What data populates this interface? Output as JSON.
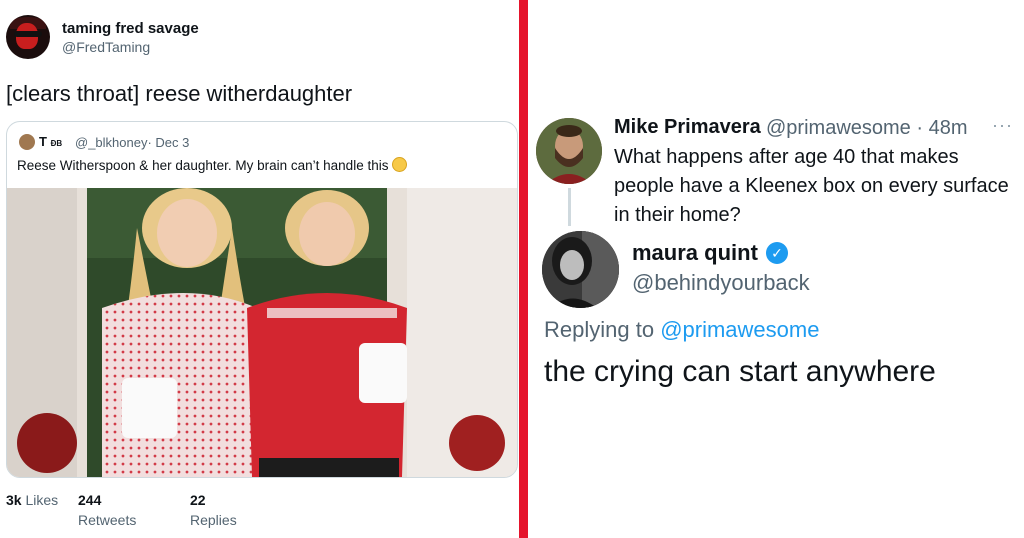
{
  "left_tweet": {
    "author_name": "taming fred savage",
    "author_handle": "@FredTaming",
    "text": "[clears throat] reese witherdaughter",
    "quote": {
      "author_name": "T",
      "author_badge": "ÐB",
      "author_handle": "@_blkhoney",
      "date": "· Dec 3",
      "text": "Reese Witherspoon & her daughter. My brain can’t handle this",
      "emoji": "slightly-smiling-face-icon"
    },
    "stats": {
      "likes_count": "3k",
      "likes_label": "Likes",
      "retweets_count": "244",
      "retweets_label": "Retweets",
      "replies_count": "22",
      "replies_label": "Replies"
    }
  },
  "right_tweet": {
    "parent": {
      "author_name": "Mike Primavera",
      "author_handle": "@primawesome",
      "time": "· 48m",
      "more": "···",
      "text": "What happens after age 40 that makes people have a Kleenex box on every surface in their home?"
    },
    "reply": {
      "author_name": "maura quint",
      "author_handle": "@behindyourback",
      "verified_mark": "✓",
      "replying_prefix": "Replying to",
      "replying_to": "@primawesome",
      "text": "the crying can start anywhere"
    }
  },
  "colors": {
    "divider": "#e5142c",
    "link": "#1d9bf0",
    "muted": "#536471",
    "text": "#0f1419"
  }
}
